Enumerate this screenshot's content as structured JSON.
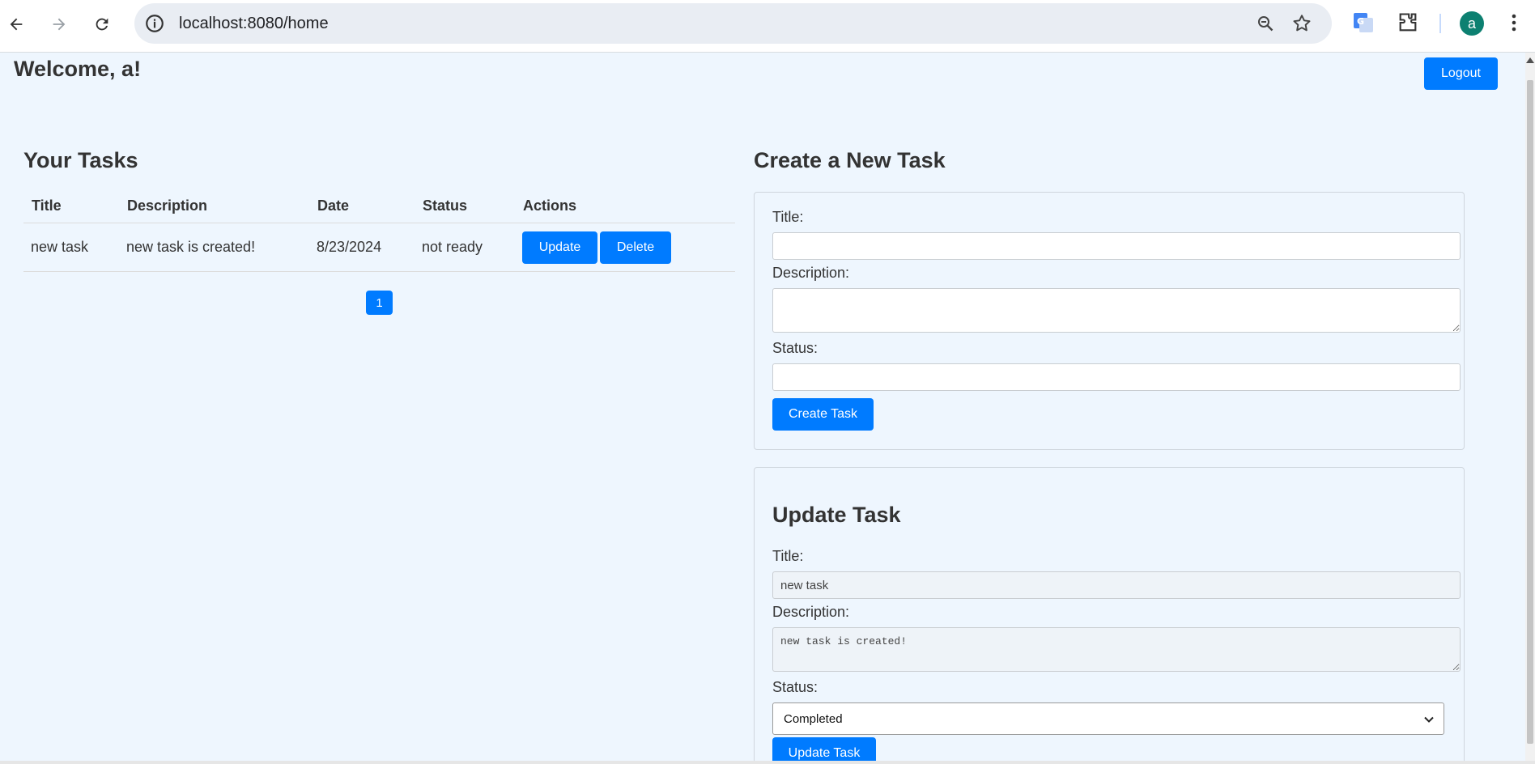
{
  "browser": {
    "url": "localhost:8080/home",
    "avatar_letter": "a"
  },
  "header": {
    "welcome": "Welcome, a!",
    "logout_label": "Logout"
  },
  "tasks": {
    "heading": "Your Tasks",
    "columns": [
      "Title",
      "Description",
      "Date",
      "Status",
      "Actions"
    ],
    "rows": [
      {
        "title": "new task",
        "description": "new task is created!",
        "date": "8/23/2024",
        "status": "not ready",
        "update_label": "Update",
        "delete_label": "Delete"
      }
    ],
    "pagination": [
      "1"
    ]
  },
  "create_form": {
    "heading": "Create a New Task",
    "title_label": "Title:",
    "description_label": "Description:",
    "status_label": "Status:",
    "title_value": "",
    "description_value": "",
    "status_value": "",
    "submit_label": "Create Task"
  },
  "update_form": {
    "heading": "Update Task",
    "title_label": "Title:",
    "description_label": "Description:",
    "status_label": "Status:",
    "title_value": "new task",
    "description_value": "new task is created!",
    "status_selected": "Completed",
    "submit_label": "Update Task"
  },
  "colors": {
    "accent": "#007bff",
    "page_bg": "#eef6fe"
  }
}
